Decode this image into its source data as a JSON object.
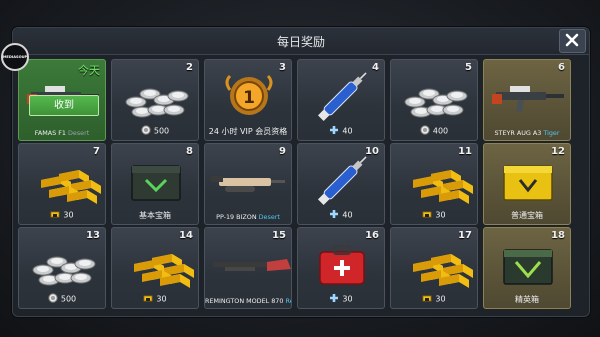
{
  "dialog": {
    "title": "每日奖励",
    "close_icon": "close-icon",
    "corner_logo": "MEDIASOUP"
  },
  "days": [
    {
      "day": "今天",
      "label": "FAMAS F1",
      "tag": "Desert",
      "item": "rifle",
      "today": true,
      "action": "收到"
    },
    {
      "day": "2",
      "amount": "500",
      "currency": "silver-coin",
      "item": "silver-coins"
    },
    {
      "day": "3",
      "label": "24 小时 VIP 会员资格",
      "item": "vip-badge"
    },
    {
      "day": "4",
      "amount": "40",
      "currency": "plus",
      "item": "syringe"
    },
    {
      "day": "5",
      "amount": "400",
      "currency": "silver-coin",
      "item": "silver-coins"
    },
    {
      "day": "6",
      "label": "STEYR AUG A3",
      "tag": "Tiger",
      "item": "rifle",
      "rare": true
    },
    {
      "day": "7",
      "amount": "30",
      "currency": "gold",
      "item": "gold-bars"
    },
    {
      "day": "8",
      "label": "基本宝箱",
      "item": "crate"
    },
    {
      "day": "9",
      "label": "PP-19 BIZON",
      "tag": "Desert",
      "item": "smg"
    },
    {
      "day": "10",
      "amount": "40",
      "currency": "plus",
      "item": "syringe"
    },
    {
      "day": "11",
      "amount": "30",
      "currency": "gold",
      "item": "gold-bars"
    },
    {
      "day": "12",
      "label": "普通宝箱",
      "item": "crate-gold",
      "rare": true
    },
    {
      "day": "13",
      "amount": "500",
      "currency": "silver-coin",
      "item": "silver-coins"
    },
    {
      "day": "14",
      "amount": "30",
      "currency": "gold",
      "item": "gold-bars"
    },
    {
      "day": "15",
      "label": "REMINGTON MODEL 870",
      "tag": "Redline",
      "item": "shotgun"
    },
    {
      "day": "16",
      "amount": "30",
      "currency": "plus",
      "item": "medkit"
    },
    {
      "day": "17",
      "amount": "30",
      "currency": "gold",
      "item": "gold-bars"
    },
    {
      "day": "18",
      "label": "精英箱",
      "item": "crate-green",
      "rare": true
    }
  ]
}
